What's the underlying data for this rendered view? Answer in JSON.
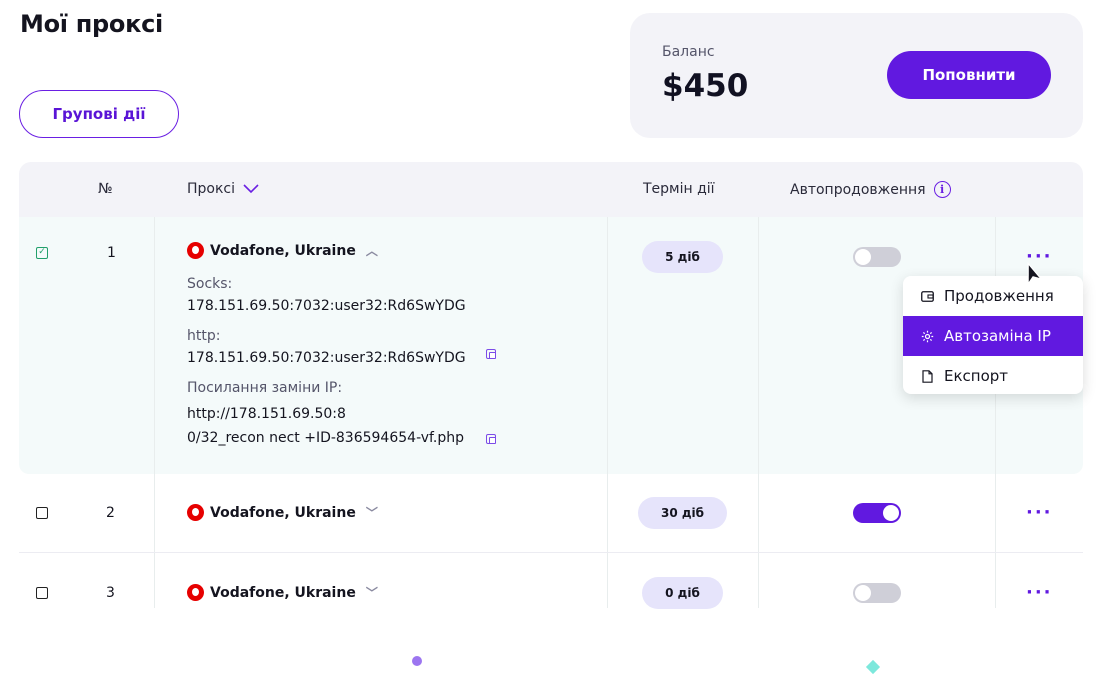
{
  "header": {
    "title": "Мої проксі",
    "group_actions_label": "Групові дії"
  },
  "balance": {
    "label": "Баланс",
    "value": "$450",
    "topup_label": "Поповнити"
  },
  "table": {
    "columns": {
      "number": "№",
      "proxy": "Проксі",
      "term": "Термін дії",
      "autorenew": "Автопродовження"
    },
    "rows": [
      {
        "checked": true,
        "number": "1",
        "operator": "Vodafone, Ukraine",
        "expanded": true,
        "term": "5 діб",
        "autorenew": false,
        "details": {
          "socks_label": "Socks:",
          "socks_value": "178.151.69.50:7032:user32:Rd6SwYDG",
          "http_label": "http:",
          "http_value": "178.151.69.50:7032:user32:Rd6SwYDG",
          "ip_change_label": "Посилання заміни IP:",
          "ip_change_line1": "http://178.151.69.50:8",
          "ip_change_line2": "0/32_recon nect +ID-836594654-vf.php"
        }
      },
      {
        "checked": false,
        "number": "2",
        "operator": "Vodafone, Ukraine",
        "expanded": false,
        "term": "30 діб",
        "autorenew": true
      },
      {
        "checked": false,
        "number": "3",
        "operator": "Vodafone, Ukraine",
        "expanded": false,
        "term": "0 діб",
        "autorenew": false
      }
    ]
  },
  "context_menu": {
    "items": [
      {
        "label": "Продовження",
        "icon": "wallet-icon",
        "active": false
      },
      {
        "label": "Автозаміна IP",
        "icon": "gear-icon",
        "active": true
      },
      {
        "label": "Експорт",
        "icon": "file-icon",
        "active": false
      }
    ]
  },
  "colors": {
    "accent": "#6119e0",
    "row_highlight": "#f4fafa",
    "header_bg": "#f3f3f8",
    "badge_bg": "#e6e4fb",
    "vodafone_red": "#e60000"
  }
}
